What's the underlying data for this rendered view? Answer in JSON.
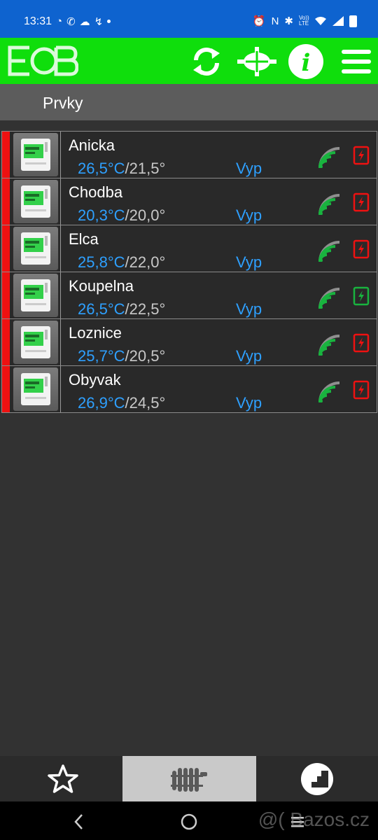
{
  "status_bar": {
    "time": "13:31",
    "left_icons": [
      "messenger-icon",
      "whatsapp-icon",
      "chat-icon",
      "missed-call-icon"
    ],
    "right_icons": [
      "alarm-icon",
      "nfc-icon",
      "bluetooth-icon",
      "volte-icon",
      "wifi-icon",
      "signal-icon",
      "battery-icon"
    ],
    "volte_label": "Vo)) LTE"
  },
  "app_bar": {
    "logo_text": "EOB",
    "buttons": [
      "refresh-icon",
      "crosshair-icon",
      "info-icon",
      "menu-icon"
    ],
    "info_label": "i",
    "color": "#0fde0c"
  },
  "section": {
    "title": "Prvky"
  },
  "rows": [
    {
      "name": "Anicka",
      "current": "26,5°C",
      "sep": "/",
      "target": "21,5°",
      "mode": "Vyp",
      "power_status": "red"
    },
    {
      "name": "Chodba",
      "current": "20,3°C",
      "sep": "/",
      "target": "20,0°",
      "mode": "Vyp",
      "power_status": "red"
    },
    {
      "name": "Elca",
      "current": "25,8°C",
      "sep": "/",
      "target": "22,0°",
      "mode": "Vyp",
      "power_status": "red"
    },
    {
      "name": "Koupelna",
      "current": "26,5°C",
      "sep": "/",
      "target": "22,5°",
      "mode": "Vyp",
      "power_status": "green"
    },
    {
      "name": "Loznice",
      "current": "25,7°C",
      "sep": "/",
      "target": "20,5°",
      "mode": "Vyp",
      "power_status": "red"
    },
    {
      "name": "Obyvak",
      "current": "26,9°C",
      "sep": "/",
      "target": "24,5°",
      "mode": "Vyp",
      "power_status": "red"
    }
  ],
  "bottom_tabs": [
    {
      "icon": "star-icon",
      "active": false
    },
    {
      "icon": "radiator-icon",
      "active": true
    },
    {
      "icon": "stairs-chart-icon",
      "active": false
    }
  ],
  "system_nav": [
    "back-icon",
    "home-icon",
    "recents-icon"
  ],
  "watermark": "@( Bazos.cz",
  "colors": {
    "accent_blue": "#2ea0ff",
    "alert_red": "#ee1111",
    "ok_green": "#19b33f"
  }
}
